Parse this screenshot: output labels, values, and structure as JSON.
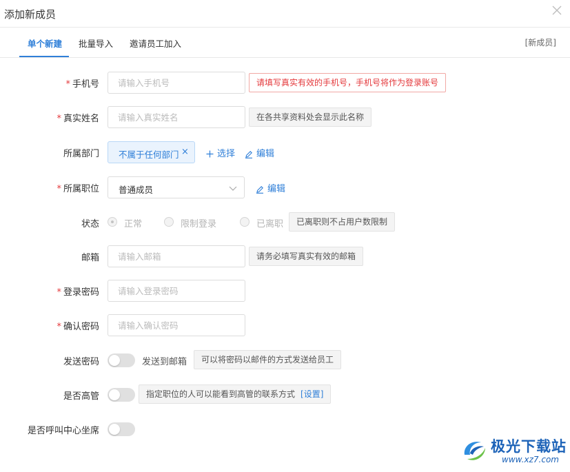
{
  "dialog": {
    "title": "添加新成员"
  },
  "tabs": {
    "items": [
      {
        "label": "单个新建"
      },
      {
        "label": "批量导入"
      },
      {
        "label": "邀请员工加入"
      }
    ],
    "right_label": "[新成员]"
  },
  "form": {
    "required_mark": "*",
    "phone": {
      "label": "手机号",
      "placeholder": "请输入手机号",
      "hint": "请填写真实有效的手机号，手机号将作为登录账号"
    },
    "real_name": {
      "label": "真实姓名",
      "placeholder": "请输入真实姓名",
      "hint": "在各共享资料处会显示此名称"
    },
    "department": {
      "label": "所属部门",
      "tag": "不属于任何部门",
      "tag_remove": "×",
      "select_label": "选择",
      "edit_label": "编辑"
    },
    "position": {
      "label": "所属职位",
      "value": "普通成员",
      "edit_label": "编辑"
    },
    "status": {
      "label": "状态",
      "options": [
        {
          "label": "正常",
          "checked": true
        },
        {
          "label": "限制登录",
          "checked": false
        },
        {
          "label": "已离职",
          "checked": false
        }
      ],
      "hint": "已离职则不占用户数限制"
    },
    "email": {
      "label": "邮箱",
      "placeholder": "请输入邮箱",
      "hint": "请务必填写真实有效的邮箱"
    },
    "login_password": {
      "label": "登录密码",
      "placeholder": "请输入登录密码"
    },
    "confirm_password": {
      "label": "确认密码",
      "placeholder": "请输入确认密码"
    },
    "send_password": {
      "label": "发送密码",
      "toggle_text": "发送到邮箱",
      "hint": "可以将密码以邮件的方式发送给员工"
    },
    "is_executive": {
      "label": "是否高管",
      "hint": "指定职位的人可以能看到高管的联系方式",
      "hint_link": "[设置]"
    },
    "call_center": {
      "label": "是否呼叫中心坐席"
    }
  },
  "watermark": {
    "text": "极光下载站",
    "url": "www.xz7.com"
  },
  "colors": {
    "accent": "#2f7fd8",
    "required": "#e4393c",
    "watermark": "#1d63b8"
  },
  "icons": {
    "close": "close-icon",
    "plus": "plus-icon",
    "edit": "pencil-icon",
    "dropdown": "chevron-down-icon"
  }
}
